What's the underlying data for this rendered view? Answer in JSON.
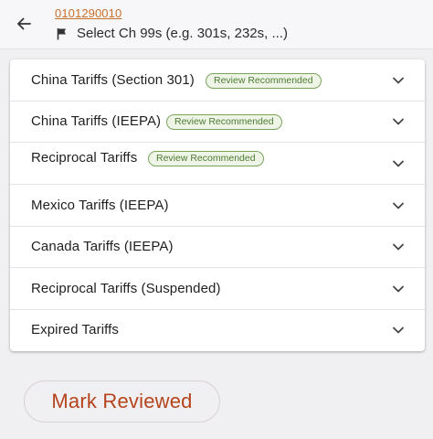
{
  "header": {
    "back_icon": "arrow-left-icon",
    "hts_code": "0101290010",
    "flag_icon": "flag-icon",
    "chapter_select_label": "Select Ch 99s (e.g. 301s, 232s, ...)"
  },
  "tariffs": [
    {
      "label": "China Tariffs (Section 301)",
      "badge": "Review Recommended"
    },
    {
      "label": "China Tariffs (IEEPA)",
      "badge": "Review Recommended"
    },
    {
      "label": "Reciprocal Tariffs",
      "badge": "Review Recommended"
    },
    {
      "label": "Mexico Tariffs (IEEPA)",
      "badge": ""
    },
    {
      "label": "Canada Tariffs (IEEPA)",
      "badge": ""
    },
    {
      "label": "Reciprocal Tariffs (Suspended)",
      "badge": ""
    },
    {
      "label": "Expired Tariffs",
      "badge": ""
    }
  ],
  "expand_icon": "chevron-down-icon",
  "actions": {
    "mark_reviewed": "Mark Reviewed"
  },
  "colors": {
    "link": "#c9702a",
    "badge_border": "#7aa35e",
    "badge_text": "#4d7a33",
    "primary_action": "#b5441c"
  }
}
